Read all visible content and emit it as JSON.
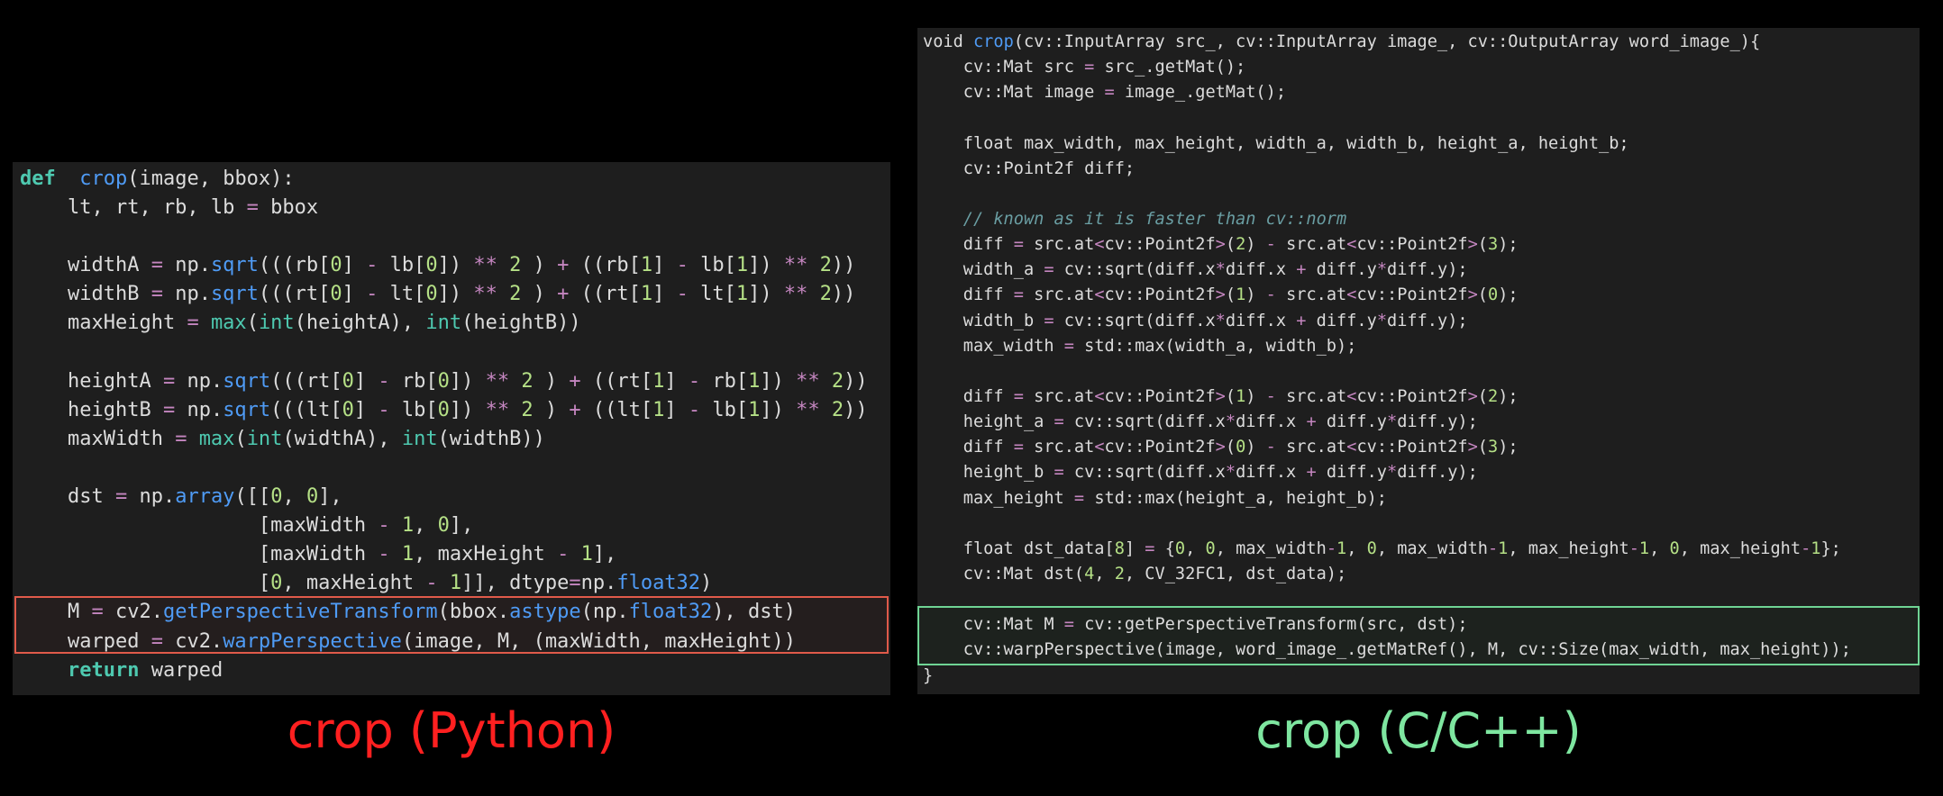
{
  "python": {
    "caption": "crop (Python)",
    "lines": [
      [
        [
          "kwg",
          "def"
        ],
        [
          "",
          "  "
        ],
        [
          "fn",
          "crop"
        ],
        [
          "",
          "(image, bbox):"
        ]
      ],
      [
        [
          "",
          "    lt, rt, rb, lb "
        ],
        [
          "op",
          "="
        ],
        [
          "",
          " bbox"
        ]
      ],
      [],
      [
        [
          "",
          "    widthA "
        ],
        [
          "op",
          "="
        ],
        [
          "",
          " np."
        ],
        [
          "fn",
          "sqrt"
        ],
        [
          "",
          "(((rb["
        ],
        [
          "num",
          "0"
        ],
        [
          "",
          "] "
        ],
        [
          "op",
          "-"
        ],
        [
          "",
          " lb["
        ],
        [
          "num",
          "0"
        ],
        [
          "",
          "]) "
        ],
        [
          "op",
          "**"
        ],
        [
          "",
          " "
        ],
        [
          "num",
          "2"
        ],
        [
          "",
          " ) "
        ],
        [
          "op",
          "+"
        ],
        [
          "",
          " ((rb["
        ],
        [
          "num",
          "1"
        ],
        [
          "",
          "] "
        ],
        [
          "op",
          "-"
        ],
        [
          "",
          " lb["
        ],
        [
          "num",
          "1"
        ],
        [
          "",
          "]) "
        ],
        [
          "op",
          "**"
        ],
        [
          "",
          " "
        ],
        [
          "num",
          "2"
        ],
        [
          "",
          "))"
        ]
      ],
      [
        [
          "",
          "    widthB "
        ],
        [
          "op",
          "="
        ],
        [
          "",
          " np."
        ],
        [
          "fn",
          "sqrt"
        ],
        [
          "",
          "(((rt["
        ],
        [
          "num",
          "0"
        ],
        [
          "",
          "] "
        ],
        [
          "op",
          "-"
        ],
        [
          "",
          " lt["
        ],
        [
          "num",
          "0"
        ],
        [
          "",
          "]) "
        ],
        [
          "op",
          "**"
        ],
        [
          "",
          " "
        ],
        [
          "num",
          "2"
        ],
        [
          "",
          " ) "
        ],
        [
          "op",
          "+"
        ],
        [
          "",
          " ((rt["
        ],
        [
          "num",
          "1"
        ],
        [
          "",
          "] "
        ],
        [
          "op",
          "-"
        ],
        [
          "",
          " lt["
        ],
        [
          "num",
          "1"
        ],
        [
          "",
          "]) "
        ],
        [
          "op",
          "**"
        ],
        [
          "",
          " "
        ],
        [
          "num",
          "2"
        ],
        [
          "",
          "))"
        ]
      ],
      [
        [
          "",
          "    maxHeight "
        ],
        [
          "op",
          "="
        ],
        [
          "",
          " "
        ],
        [
          "bi",
          "max"
        ],
        [
          "",
          "("
        ],
        [
          "bi",
          "int"
        ],
        [
          "",
          "(heightA), "
        ],
        [
          "bi",
          "int"
        ],
        [
          "",
          "(heightB))"
        ]
      ],
      [],
      [
        [
          "",
          "    heightA "
        ],
        [
          "op",
          "="
        ],
        [
          "",
          " np."
        ],
        [
          "fn",
          "sqrt"
        ],
        [
          "",
          "(((rt["
        ],
        [
          "num",
          "0"
        ],
        [
          "",
          "] "
        ],
        [
          "op",
          "-"
        ],
        [
          "",
          " rb["
        ],
        [
          "num",
          "0"
        ],
        [
          "",
          "]) "
        ],
        [
          "op",
          "**"
        ],
        [
          "",
          " "
        ],
        [
          "num",
          "2"
        ],
        [
          "",
          " ) "
        ],
        [
          "op",
          "+"
        ],
        [
          "",
          " ((rt["
        ],
        [
          "num",
          "1"
        ],
        [
          "",
          "] "
        ],
        [
          "op",
          "-"
        ],
        [
          "",
          " rb["
        ],
        [
          "num",
          "1"
        ],
        [
          "",
          "]) "
        ],
        [
          "op",
          "**"
        ],
        [
          "",
          " "
        ],
        [
          "num",
          "2"
        ],
        [
          "",
          "))"
        ]
      ],
      [
        [
          "",
          "    heightB "
        ],
        [
          "op",
          "="
        ],
        [
          "",
          " np."
        ],
        [
          "fn",
          "sqrt"
        ],
        [
          "",
          "(((lt["
        ],
        [
          "num",
          "0"
        ],
        [
          "",
          "] "
        ],
        [
          "op",
          "-"
        ],
        [
          "",
          " lb["
        ],
        [
          "num",
          "0"
        ],
        [
          "",
          "]) "
        ],
        [
          "op",
          "**"
        ],
        [
          "",
          " "
        ],
        [
          "num",
          "2"
        ],
        [
          "",
          " ) "
        ],
        [
          "op",
          "+"
        ],
        [
          "",
          " ((lt["
        ],
        [
          "num",
          "1"
        ],
        [
          "",
          "] "
        ],
        [
          "op",
          "-"
        ],
        [
          "",
          " lb["
        ],
        [
          "num",
          "1"
        ],
        [
          "",
          "]) "
        ],
        [
          "op",
          "**"
        ],
        [
          "",
          " "
        ],
        [
          "num",
          "2"
        ],
        [
          "",
          "))"
        ]
      ],
      [
        [
          "",
          "    maxWidth "
        ],
        [
          "op",
          "="
        ],
        [
          "",
          " "
        ],
        [
          "bi",
          "max"
        ],
        [
          "",
          "("
        ],
        [
          "bi",
          "int"
        ],
        [
          "",
          "(widthA), "
        ],
        [
          "bi",
          "int"
        ],
        [
          "",
          "(widthB))"
        ]
      ],
      [],
      [
        [
          "",
          "    dst "
        ],
        [
          "op",
          "="
        ],
        [
          "",
          " np."
        ],
        [
          "fn",
          "array"
        ],
        [
          "",
          "([["
        ],
        [
          "num",
          "0"
        ],
        [
          "",
          ", "
        ],
        [
          "num",
          "0"
        ],
        [
          "",
          "],"
        ]
      ],
      [
        [
          "",
          "                    [maxWidth "
        ],
        [
          "op",
          "-"
        ],
        [
          "",
          " "
        ],
        [
          "num",
          "1"
        ],
        [
          "",
          ", "
        ],
        [
          "num",
          "0"
        ],
        [
          "",
          "],"
        ]
      ],
      [
        [
          "",
          "                    [maxWidth "
        ],
        [
          "op",
          "-"
        ],
        [
          "",
          " "
        ],
        [
          "num",
          "1"
        ],
        [
          "",
          ", maxHeight "
        ],
        [
          "op",
          "-"
        ],
        [
          "",
          " "
        ],
        [
          "num",
          "1"
        ],
        [
          "",
          "],"
        ]
      ],
      [
        [
          "",
          "                    ["
        ],
        [
          "num",
          "0"
        ],
        [
          "",
          ", maxHeight "
        ],
        [
          "op",
          "-"
        ],
        [
          "",
          " "
        ],
        [
          "num",
          "1"
        ],
        [
          "",
          "]], dtype"
        ],
        [
          "op",
          "="
        ],
        [
          "",
          "np."
        ],
        [
          "fn",
          "float32"
        ],
        [
          "",
          ")"
        ]
      ],
      [
        [
          "",
          "    M "
        ],
        [
          "op",
          "="
        ],
        [
          "",
          " cv2."
        ],
        [
          "fn",
          "getPerspectiveTransform"
        ],
        [
          "",
          "(bbox."
        ],
        [
          "fn",
          "astype"
        ],
        [
          "",
          "(np."
        ],
        [
          "fn",
          "float32"
        ],
        [
          "",
          "), dst)"
        ]
      ],
      [
        [
          "",
          "    warped "
        ],
        [
          "op",
          "="
        ],
        [
          "",
          " cv2."
        ],
        [
          "fn",
          "warpPerspective"
        ],
        [
          "",
          "(image, M, (maxWidth, maxHeight))"
        ]
      ],
      [
        [
          "",
          "    "
        ],
        [
          "kwr",
          "return"
        ],
        [
          "",
          " warped"
        ]
      ]
    ]
  },
  "cpp": {
    "caption": "crop (C/C++)",
    "lines": [
      [
        [
          "",
          "void "
        ],
        [
          "fn",
          "crop"
        ],
        [
          "",
          "(cv::InputArray src_, cv::InputArray image_, cv::OutputArray word_image_){"
        ]
      ],
      [
        [
          "",
          "    cv::Mat src "
        ],
        [
          "op",
          "="
        ],
        [
          "",
          " src_.getMat();"
        ]
      ],
      [
        [
          "",
          "    cv::Mat image "
        ],
        [
          "op",
          "="
        ],
        [
          "",
          " image_.getMat();"
        ]
      ],
      [],
      [
        [
          "",
          "    float max_width, max_height, width_a, width_b, height_a, height_b;"
        ]
      ],
      [
        [
          "",
          "    cv::Point2f diff;"
        ]
      ],
      [],
      [
        [
          "",
          "    "
        ],
        [
          "cmt",
          "// known as it is faster than cv::norm"
        ]
      ],
      [
        [
          "",
          "    diff "
        ],
        [
          "op",
          "="
        ],
        [
          "",
          " src.at"
        ],
        [
          "op",
          "<"
        ],
        [
          "",
          "cv::Point2f"
        ],
        [
          "op",
          ">"
        ],
        [
          "",
          "("
        ],
        [
          "num",
          "2"
        ],
        [
          "",
          ") "
        ],
        [
          "op",
          "-"
        ],
        [
          "",
          " src.at"
        ],
        [
          "op",
          "<"
        ],
        [
          "",
          "cv::Point2f"
        ],
        [
          "op",
          ">"
        ],
        [
          "",
          "("
        ],
        [
          "num",
          "3"
        ],
        [
          "",
          ");"
        ]
      ],
      [
        [
          "",
          "    width_a "
        ],
        [
          "op",
          "="
        ],
        [
          "",
          " cv::sqrt(diff.x"
        ],
        [
          "op",
          "*"
        ],
        [
          "",
          "diff.x "
        ],
        [
          "op",
          "+"
        ],
        [
          "",
          " diff.y"
        ],
        [
          "op",
          "*"
        ],
        [
          "",
          "diff.y);"
        ]
      ],
      [
        [
          "",
          "    diff "
        ],
        [
          "op",
          "="
        ],
        [
          "",
          " src.at"
        ],
        [
          "op",
          "<"
        ],
        [
          "",
          "cv::Point2f"
        ],
        [
          "op",
          ">"
        ],
        [
          "",
          "("
        ],
        [
          "num",
          "1"
        ],
        [
          "",
          ") "
        ],
        [
          "op",
          "-"
        ],
        [
          "",
          " src.at"
        ],
        [
          "op",
          "<"
        ],
        [
          "",
          "cv::Point2f"
        ],
        [
          "op",
          ">"
        ],
        [
          "",
          "("
        ],
        [
          "num",
          "0"
        ],
        [
          "",
          ");"
        ]
      ],
      [
        [
          "",
          "    width_b "
        ],
        [
          "op",
          "="
        ],
        [
          "",
          " cv::sqrt(diff.x"
        ],
        [
          "op",
          "*"
        ],
        [
          "",
          "diff.x "
        ],
        [
          "op",
          "+"
        ],
        [
          "",
          " diff.y"
        ],
        [
          "op",
          "*"
        ],
        [
          "",
          "diff.y);"
        ]
      ],
      [
        [
          "",
          "    max_width "
        ],
        [
          "op",
          "="
        ],
        [
          "",
          " std::max(width_a, width_b);"
        ]
      ],
      [],
      [
        [
          "",
          "    diff "
        ],
        [
          "op",
          "="
        ],
        [
          "",
          " src.at"
        ],
        [
          "op",
          "<"
        ],
        [
          "",
          "cv::Point2f"
        ],
        [
          "op",
          ">"
        ],
        [
          "",
          "("
        ],
        [
          "num",
          "1"
        ],
        [
          "",
          ") "
        ],
        [
          "op",
          "-"
        ],
        [
          "",
          " src.at"
        ],
        [
          "op",
          "<"
        ],
        [
          "",
          "cv::Point2f"
        ],
        [
          "op",
          ">"
        ],
        [
          "",
          "("
        ],
        [
          "num",
          "2"
        ],
        [
          "",
          ");"
        ]
      ],
      [
        [
          "",
          "    height_a "
        ],
        [
          "op",
          "="
        ],
        [
          "",
          " cv::sqrt(diff.x"
        ],
        [
          "op",
          "*"
        ],
        [
          "",
          "diff.x "
        ],
        [
          "op",
          "+"
        ],
        [
          "",
          " diff.y"
        ],
        [
          "op",
          "*"
        ],
        [
          "",
          "diff.y);"
        ]
      ],
      [
        [
          "",
          "    diff "
        ],
        [
          "op",
          "="
        ],
        [
          "",
          " src.at"
        ],
        [
          "op",
          "<"
        ],
        [
          "",
          "cv::Point2f"
        ],
        [
          "op",
          ">"
        ],
        [
          "",
          "("
        ],
        [
          "num",
          "0"
        ],
        [
          "",
          ") "
        ],
        [
          "op",
          "-"
        ],
        [
          "",
          " src.at"
        ],
        [
          "op",
          "<"
        ],
        [
          "",
          "cv::Point2f"
        ],
        [
          "op",
          ">"
        ],
        [
          "",
          "("
        ],
        [
          "num",
          "3"
        ],
        [
          "",
          ");"
        ]
      ],
      [
        [
          "",
          "    height_b "
        ],
        [
          "op",
          "="
        ],
        [
          "",
          " cv::sqrt(diff.x"
        ],
        [
          "op",
          "*"
        ],
        [
          "",
          "diff.x "
        ],
        [
          "op",
          "+"
        ],
        [
          "",
          " diff.y"
        ],
        [
          "op",
          "*"
        ],
        [
          "",
          "diff.y);"
        ]
      ],
      [
        [
          "",
          "    max_height "
        ],
        [
          "op",
          "="
        ],
        [
          "",
          " std::max(height_a, height_b);"
        ]
      ],
      [],
      [
        [
          "",
          "    float dst_data["
        ],
        [
          "num",
          "8"
        ],
        [
          "",
          "] "
        ],
        [
          "op",
          "="
        ],
        [
          "",
          " {"
        ],
        [
          "num",
          "0"
        ],
        [
          "",
          ", "
        ],
        [
          "num",
          "0"
        ],
        [
          "",
          ", max_width"
        ],
        [
          "op",
          "-"
        ],
        [
          "num",
          "1"
        ],
        [
          "",
          ", "
        ],
        [
          "num",
          "0"
        ],
        [
          "",
          ", max_width"
        ],
        [
          "op",
          "-"
        ],
        [
          "num",
          "1"
        ],
        [
          "",
          ", max_height"
        ],
        [
          "op",
          "-"
        ],
        [
          "num",
          "1"
        ],
        [
          "",
          ", "
        ],
        [
          "num",
          "0"
        ],
        [
          "",
          ", max_height"
        ],
        [
          "op",
          "-"
        ],
        [
          "num",
          "1"
        ],
        [
          "",
          "};"
        ]
      ],
      [
        [
          "",
          "    cv::Mat dst("
        ],
        [
          "num",
          "4"
        ],
        [
          "",
          ", "
        ],
        [
          "num",
          "2"
        ],
        [
          "",
          ", CV_32FC1, dst_data);"
        ]
      ],
      [],
      [
        [
          "",
          "    cv::Mat M "
        ],
        [
          "op",
          "="
        ],
        [
          "",
          " cv::getPerspectiveTransform(src, dst);"
        ]
      ],
      [
        [
          "",
          "    cv::warpPerspective(image, word_image_.getMatRef(), M, cv::Size(max_width, max_height));"
        ]
      ],
      [
        [
          "",
          "}"
        ]
      ]
    ]
  },
  "colors": {
    "background": "#000000",
    "editor_background": "#1e1e1e",
    "python_caption": "#ff2020",
    "cpp_caption": "#7ee6a0",
    "python_highlight_border": "#e05a4a",
    "cpp_highlight_border": "#6fd494"
  }
}
